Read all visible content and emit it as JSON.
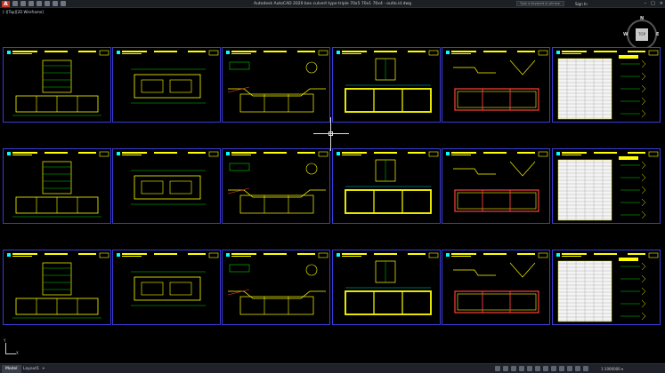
{
  "app": {
    "logo": "A",
    "title": "Autodesk AutoCAD 2020   box culvert type triple 70x5 70x1 70x4 - outlo.id.dwg",
    "search_placeholder": "Type a keyword or phrase",
    "sign_in": "Sign In",
    "window_controls": [
      "–",
      "□",
      "×"
    ]
  },
  "viewport": {
    "label": "[–][Top][2D Wireframe]",
    "viewcube": {
      "north": "N",
      "south": "S",
      "east": "E",
      "west": "W",
      "face": "TOP"
    }
  },
  "drawing": {
    "rows": 3,
    "sheet_types": [
      "section-elevation",
      "plan-frame",
      "long-section",
      "box-section",
      "reinforcement",
      "schedule"
    ],
    "colors": {
      "frame": "#3b3bd7",
      "primary": "#ffff00",
      "secondary": "#00d000",
      "accent": "#ff4040",
      "note": "#00ffff"
    }
  },
  "ucs": {
    "x": "X",
    "y": "Y"
  },
  "status": {
    "tabs": [
      "Model",
      "Layout1",
      "+"
    ],
    "scale": "1:1000000 ▾"
  }
}
